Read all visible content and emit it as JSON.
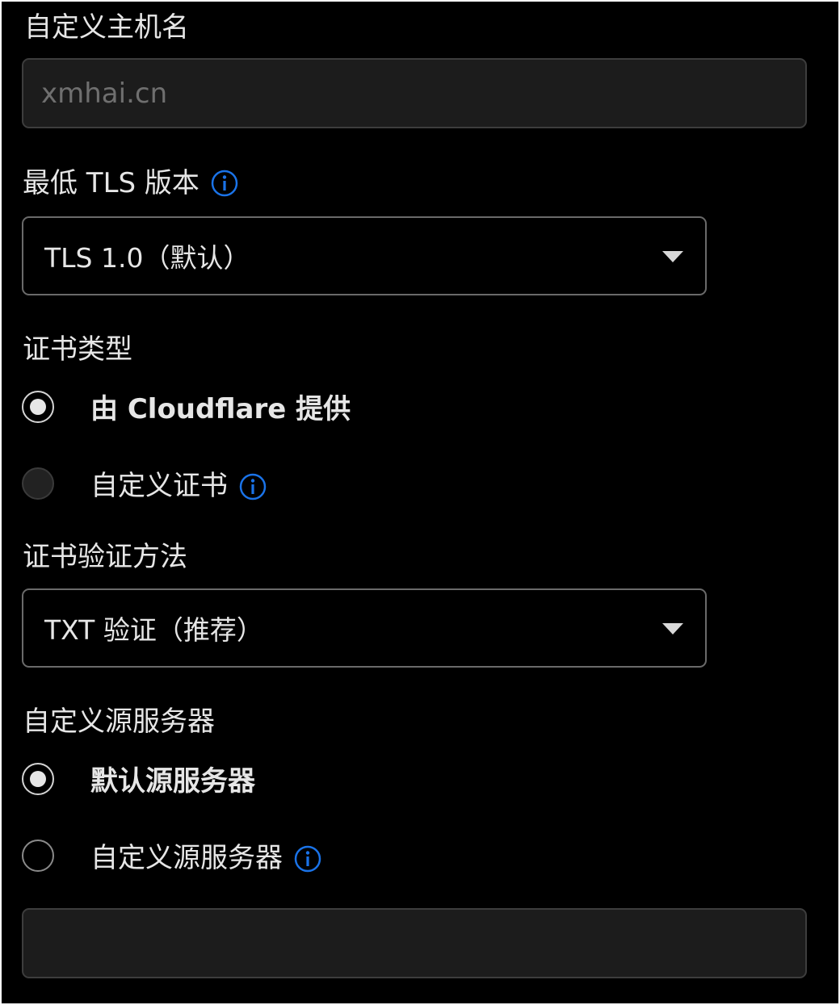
{
  "hostname": {
    "label": "自定义主机名",
    "placeholder": "xmhai.cn"
  },
  "tls": {
    "label": "最低 TLS 版本",
    "selected": "TLS 1.0（默认）"
  },
  "cert_type": {
    "label": "证书类型",
    "options": [
      {
        "label": "由 Cloudflare 提供",
        "checked": true
      },
      {
        "label": "自定义证书",
        "checked": false,
        "disabled": true
      }
    ]
  },
  "validation": {
    "label": "证书验证方法",
    "selected": "TXT 验证（推荐）"
  },
  "origin": {
    "label": "自定义源服务器",
    "options": [
      {
        "label": "默认源服务器",
        "checked": true
      },
      {
        "label": "自定义源服务器",
        "checked": false
      }
    ],
    "input_value": ""
  },
  "colors": {
    "background": "#000000",
    "text": "#e6e6e6",
    "accent": "#1a73e8",
    "input_background": "#1c1c1c"
  },
  "icons": {
    "info": "info-icon",
    "dropdown": "caret-down-icon"
  }
}
